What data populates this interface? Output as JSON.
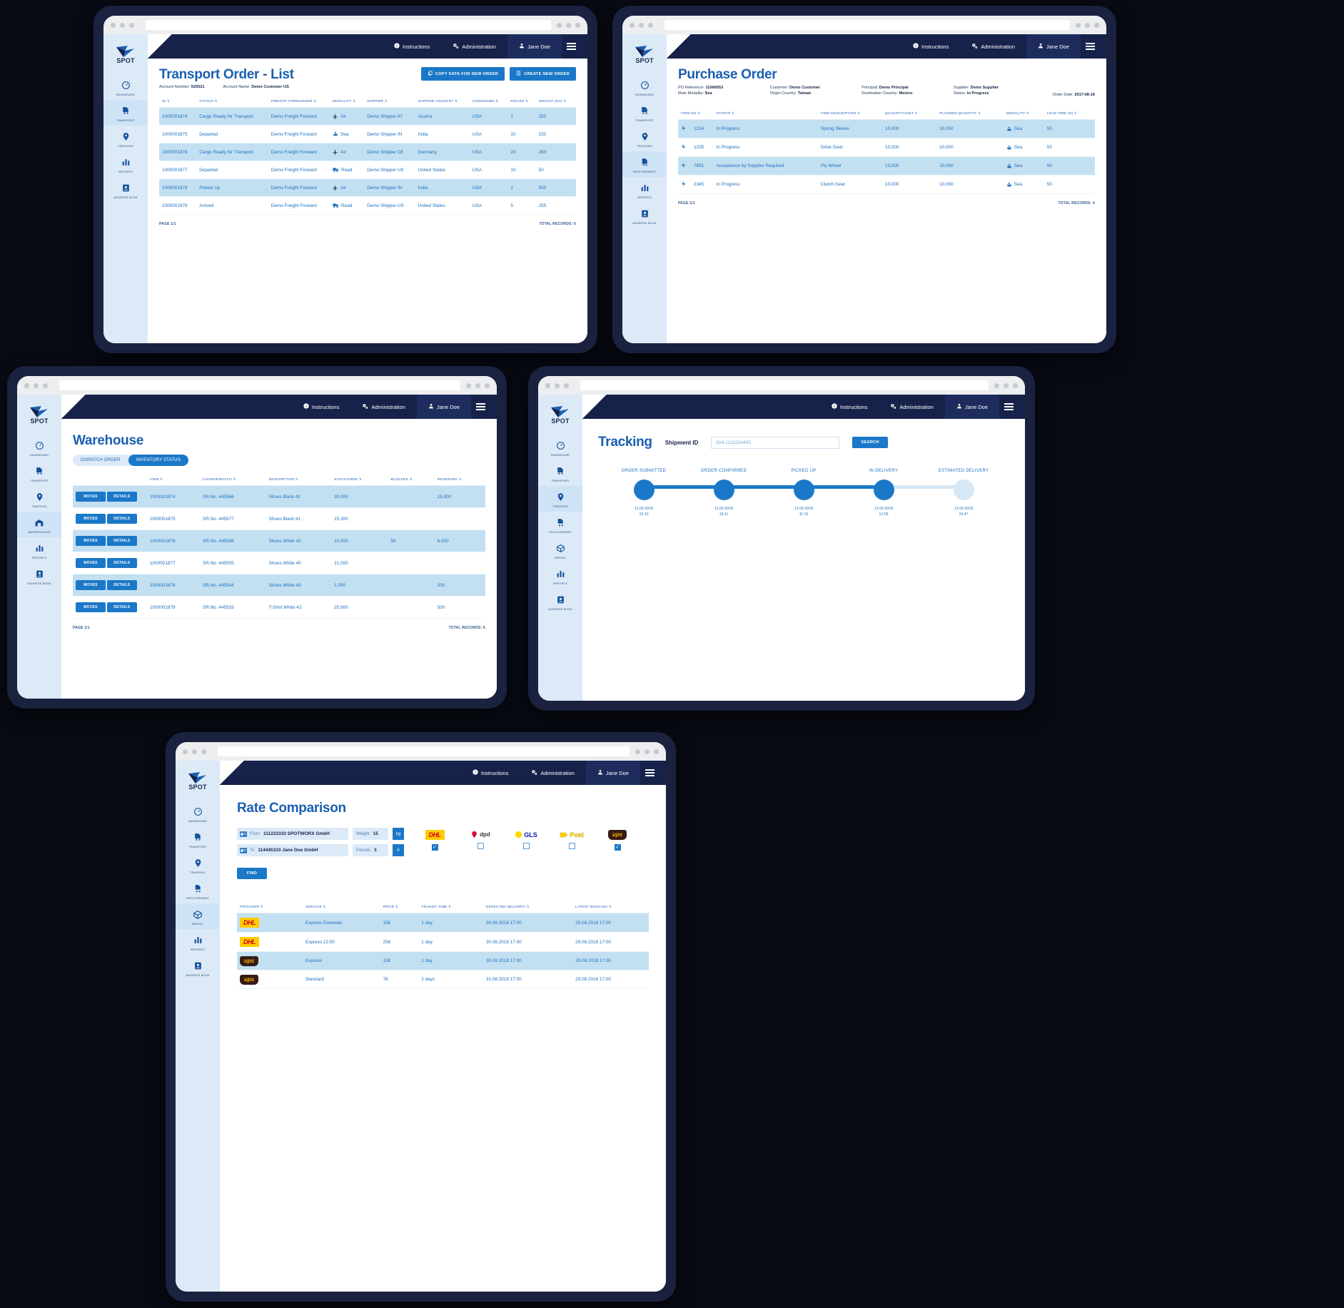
{
  "common": {
    "brand": "SPOT",
    "topbar": {
      "instructions": "Instructions",
      "administration": "Administration",
      "user": "Jane Doe"
    },
    "nav": [
      {
        "label": "DASHBOARD",
        "icon": "gauge-icon"
      },
      {
        "label": "TRANSPORT",
        "icon": "truck-doc-icon"
      },
      {
        "label": "TRACKING",
        "icon": "map-pin-icon"
      },
      {
        "label": "PROCUREMENT",
        "icon": "cart-doc-icon"
      },
      {
        "label": "WAREHOUSING",
        "icon": "warehouse-icon"
      },
      {
        "label": "PARCEL",
        "icon": "box-icon"
      },
      {
        "label": "REPORTS",
        "icon": "bar-chart-icon"
      },
      {
        "label": "ADDRESS BOOK",
        "icon": "address-book-icon"
      }
    ]
  },
  "transport": {
    "title": "Transport Order - List",
    "nav": [
      "DASHBOARD",
      "TRANSPORT",
      "TRACKING",
      "REPORTS",
      "ADDRESS BOOK"
    ],
    "active_nav": "TRANSPORT",
    "meta": [
      {
        "label": "Account Number:",
        "value": "525521"
      },
      {
        "label": "Account Name:",
        "value": "Demo Customer US"
      }
    ],
    "buttons": [
      {
        "label": "COPY DATA FOR NEW ORDER",
        "icon": "copy-icon"
      },
      {
        "label": "CREATE NEW ORDER",
        "icon": "file-plus-icon"
      }
    ],
    "columns": [
      "ID",
      "STATUS",
      "FREIGHT FORWARDER",
      "MODALITY",
      "SHIPPER",
      "SHIPPER COUNTRY",
      "CONSIGNEE",
      "PIECES",
      "WEIGHT (KG)"
    ],
    "rows": [
      [
        "1000001874",
        "Cargo Ready for Transport",
        "Demo Freight Forward",
        "Air",
        "Demo Shipper AT",
        "Austria",
        "USA",
        "1",
        "250"
      ],
      [
        "1000001875",
        "Departed",
        "Demo Freight Forward",
        "Sea",
        "Demo Shipper IN",
        "India",
        "USA",
        "10",
        "150"
      ],
      [
        "1000001876",
        "Cargo Ready for Transport",
        "Demo Freight Forward",
        "Air",
        "Demo Shipper DE",
        "Germany",
        "USA",
        "20",
        "250"
      ],
      [
        "1000001877",
        "Departed",
        "Demo Freight Forward",
        "Road",
        "Demo Shipper US",
        "United States",
        "USA",
        "10",
        "50"
      ],
      [
        "1000001878",
        "Picked Up",
        "Demo Freight Forward",
        "Air",
        "Demo Shipper IN",
        "India",
        "USA",
        "2",
        "550"
      ],
      [
        "1000001879",
        "Arrived",
        "Demo Freight Forward",
        "Road",
        "Demo Shipper US",
        "United States",
        "USA",
        "5",
        "255"
      ]
    ],
    "footer": {
      "page": "PAGE 1/1",
      "total": "TOTAL RECORDS: 6"
    }
  },
  "purchase": {
    "title": "Purchase Order",
    "nav": [
      "DASHBOARD",
      "TRANSPORT",
      "TRACKING",
      "PROCUREMENT",
      "REPORTS",
      "ADDRESS BOOK"
    ],
    "active_nav": "PROCUREMENT",
    "meta": [
      {
        "label": "PO Reference:",
        "value": "11066053"
      },
      {
        "label": "Customer:",
        "value": "Demo Customer"
      },
      {
        "label": "Principal:",
        "value": "Demo Principal"
      },
      {
        "label": "Supplier:",
        "value": "Demo Supplier"
      },
      {
        "label": "Main Modality:",
        "value": "Sea"
      },
      {
        "label": "Origin Country:",
        "value": "Taiwan"
      },
      {
        "label": "Destination Country:",
        "value": "Mexico"
      },
      {
        "label": "Status:",
        "value": "In Progress"
      }
    ],
    "order_date": {
      "label": "Order Date:",
      "value": "2017-08-16"
    },
    "columns": [
      "ITEM NO",
      "STATUS",
      "ITEM DESCRIPTION",
      "QUANTITY/UNIT",
      "PLANNED QUANTITY",
      "MODALITY",
      "LEAD TIME (D)"
    ],
    "rows": [
      [
        "1234",
        "In Progress",
        "Spring Sleeve",
        "10,000",
        "10,000",
        "Sea",
        "50"
      ],
      [
        "1235",
        "In Progress",
        "Drive Gear",
        "10,000",
        "10,000",
        "Sea",
        "50"
      ],
      [
        "7891",
        "Acceptance by Supplier Required",
        "Fly Wheel",
        "10,000",
        "10,000",
        "Sea",
        "50"
      ],
      [
        "2345",
        "In Progress",
        "Clutch Gear",
        "10,000",
        "10,000",
        "Sea",
        "50"
      ]
    ],
    "footer": {
      "page": "PAGE 1/1",
      "total": "TOTAL RECORDS: 4"
    }
  },
  "warehouse": {
    "title": "Warehouse",
    "nav": [
      "DASHBOARD",
      "TRANSPORT",
      "TRACKING",
      "WAREHOUSING",
      "REPORTS",
      "ADDRESS BOOK"
    ],
    "active_nav": "WAREHOUSING",
    "tabs": [
      {
        "label": "DISPATCH ORDER",
        "active": false
      },
      {
        "label": "INVENTORY STATUS",
        "active": true
      }
    ],
    "row_buttons": [
      "MOVES",
      "DETAILS"
    ],
    "columns": [
      "",
      "ITEM",
      "CHARGE/BATCH",
      "DESCRIPTION",
      "STOCK/FREE",
      "BLOCKED",
      "RESERVED"
    ],
    "rows": [
      [
        "1000001874",
        "SR.No. 445566",
        "Shoes Black 42",
        "20,000",
        "",
        "15,000"
      ],
      [
        "1000001875",
        "SR.No. 445577",
        "Shoes Black 41",
        "15,300",
        "",
        ""
      ],
      [
        "1000001876",
        "SR.No. 445588",
        "Shoes White 42",
        "10,000",
        "50",
        "6,000"
      ],
      [
        "1000001877",
        "SR.No. 445555",
        "Shoes White 40",
        "21,000",
        "",
        ""
      ],
      [
        "1000001878",
        "SR.No. 445544",
        "Shoes White 43",
        "1,000",
        "",
        "200"
      ],
      [
        "1000001879",
        "SR.No. 445533",
        "T-Shirt White 42",
        "25,000",
        "",
        "500"
      ]
    ],
    "footer": {
      "page": "PAGE 1/1",
      "total": "TOTAL RECORDS: 6"
    }
  },
  "tracking": {
    "title": "Tracking",
    "nav": [
      "DASHBOARD",
      "TRANSPORT",
      "TRACKING",
      "PROCUREMENT",
      "PARCEL",
      "REPORTS",
      "ADDRESS BOOK"
    ],
    "active_nav": "TRACKING",
    "shipment_label": "Shipment ID",
    "shipment_value": "DHL1122334455",
    "search_button": "SEARCH",
    "steps": [
      {
        "name": "ORDER SUBMITTED",
        "date": "11.09.2018",
        "time": "16:10",
        "done": true
      },
      {
        "name": "ORDER CONFIRMED",
        "date": "11.09.2018",
        "time": "16:11",
        "done": true
      },
      {
        "name": "PICKED UP",
        "date": "12.09.2018",
        "time": "11:16",
        "done": true
      },
      {
        "name": "IN DELIVERY",
        "date": "12.09.2018",
        "time": "12:09",
        "done": true
      },
      {
        "name": "ESTIMATED DELIVERY",
        "date": "12.09.2018",
        "time": "15:47",
        "done": false
      }
    ]
  },
  "rate": {
    "title": "Rate Comparison",
    "nav": [
      "DASHBOARD",
      "TRANSPORT",
      "TRACKING",
      "PROCUREMENT",
      "PARCEL",
      "REPORTS",
      "ADDRESS BOOK"
    ],
    "active_nav": "PARCEL",
    "from": {
      "label": "From",
      "value": "111222333 SPOTWORX GmbH",
      "icon": "address-card-icon"
    },
    "to": {
      "label": "To",
      "value": "114445333 Jane Doe GmbH",
      "icon": "address-card-icon"
    },
    "weight": {
      "label": "Weight",
      "value": "15",
      "unit": "kg"
    },
    "parcels": {
      "label": "Parcels",
      "value": "3",
      "unit": "#"
    },
    "find_button": "FIND",
    "carriers": [
      {
        "name": "DHL",
        "checked": true
      },
      {
        "name": "dpd",
        "checked": false
      },
      {
        "name": "GLS",
        "checked": false
      },
      {
        "name": "Post",
        "checked": false
      },
      {
        "name": "ups",
        "checked": true
      }
    ],
    "columns": [
      "PROVIDER",
      "SERVICE",
      "PRICE",
      "TRANSIT TIME",
      "EXPECTED DELIVERY",
      "LATEST BOOKING"
    ],
    "rows": [
      {
        "provider": "DHL",
        "service": "Express Domestic",
        "price": "15€",
        "transit": "1 day",
        "expected": "30.08.2018 17:00",
        "latest": "29.08.2018 17:00"
      },
      {
        "provider": "DHL",
        "service": "Express 12:00",
        "price": "25€",
        "transit": "1 day",
        "expected": "30.08.2018 17:00",
        "latest": "29.08.2018 17:00"
      },
      {
        "provider": "ups",
        "service": "Express",
        "price": "12€",
        "transit": "1 day",
        "expected": "30.08.2018 17:00",
        "latest": "29.08.2018 17:00"
      },
      {
        "provider": "ups",
        "service": "Standard",
        "price": "7€",
        "transit": "2 days",
        "expected": "31.08.2018 17:00",
        "latest": "29.08.2018 17:00"
      }
    ]
  },
  "colors": {
    "navy": "#16224a",
    "blue": "#1b78c8",
    "link_blue": "#1b6fbe",
    "row_alt": "#c3e0f2",
    "sidebar": "#dceaf7"
  }
}
